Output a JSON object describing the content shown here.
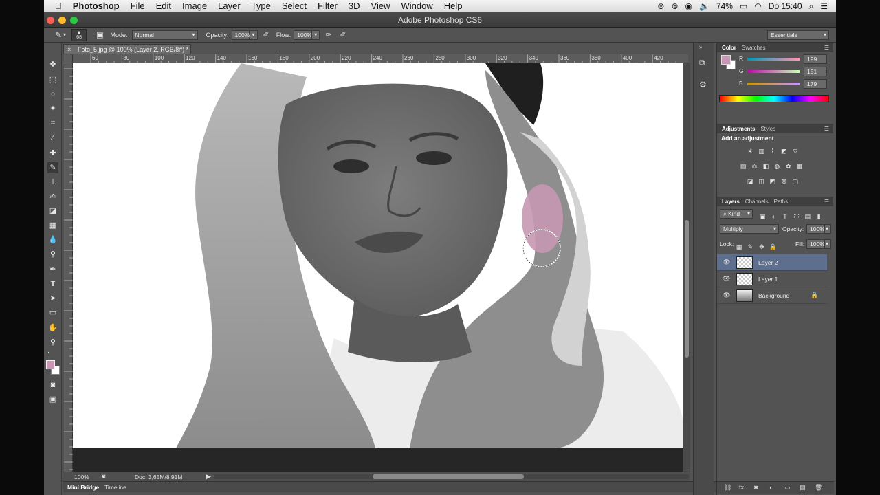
{
  "menubar": {
    "apple": "",
    "app": "Photoshop",
    "items": [
      "File",
      "Edit",
      "Image",
      "Layer",
      "Type",
      "Select",
      "Filter",
      "3D",
      "View",
      "Window",
      "Help"
    ],
    "battery": "74%",
    "clock": "Do 15:40"
  },
  "window": {
    "title": "Adobe Photoshop CS6"
  },
  "options": {
    "brush_size": "68",
    "mode_label": "Mode:",
    "mode_value": "Normal",
    "opacity_label": "Opacity:",
    "opacity_value": "100%",
    "flow_label": "Flow:",
    "flow_value": "100%",
    "workspace": "Essentials"
  },
  "document": {
    "tab": "Foto_5.jpg @ 100% (Layer 2, RGB/8#) *",
    "ruler_ticks": [
      "60",
      "80",
      "100",
      "120",
      "140",
      "160",
      "180",
      "200",
      "220",
      "240",
      "260",
      "280",
      "300",
      "320",
      "340",
      "360",
      "380",
      "400",
      "420"
    ],
    "zoom": "100%",
    "doc_size": "Doc: 3,65M/8,91M"
  },
  "bottom_tabs": [
    "Mini Bridge",
    "Timeline"
  ],
  "color_panel": {
    "tabs": [
      "Color",
      "Swatches"
    ],
    "r_label": "R",
    "r": "199",
    "g_label": "G",
    "g": "151",
    "b_label": "B",
    "b": "179",
    "fg_color": "#c797b3"
  },
  "adjustments_panel": {
    "tabs": [
      "Adjustments",
      "Styles"
    ],
    "heading": "Add an adjustment"
  },
  "layers_panel": {
    "tabs": [
      "Layers",
      "Channels",
      "Paths"
    ],
    "kind": "Kind",
    "blend_mode": "Multiply",
    "opacity_label": "Opacity:",
    "opacity": "100%",
    "lock_label": "Lock:",
    "fill_label": "Fill:",
    "fill": "100%",
    "layers": [
      {
        "name": "Layer 2",
        "selected": true
      },
      {
        "name": "Layer 1",
        "selected": false
      },
      {
        "name": "Background",
        "selected": false,
        "locked": true
      }
    ]
  },
  "colors": {
    "accent_selected": "#5d6f8d",
    "paint": "#c797b3"
  }
}
